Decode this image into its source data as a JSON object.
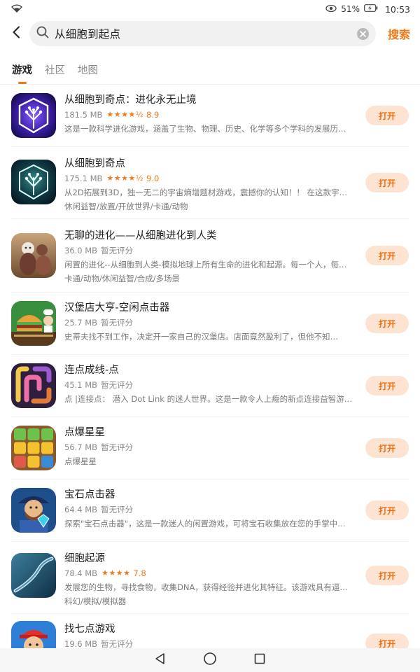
{
  "status_bar": {
    "battery": "51%",
    "time": "10:53"
  },
  "search": {
    "query": "从细胞到起点",
    "submit_label": "搜索"
  },
  "tabs": [
    {
      "label": "游戏",
      "active": true
    },
    {
      "label": "社区",
      "active": false
    },
    {
      "label": "地图",
      "active": false
    }
  ],
  "colors": {
    "accent": "#f07a1a",
    "button_bg": "#fde4d2"
  },
  "apps": [
    {
      "name": "从细胞到奇点：进化永无止境",
      "size": "181.5 MB",
      "stars": "★★★★½",
      "rating": "8.9",
      "desc": "这是一款科学进化游戏，涵盖了生物、物理、历史、化学等多个学科的发展历…",
      "tags": "",
      "button": "打开",
      "icon": "cell-to-singularity-tree-icon"
    },
    {
      "name": "从细胞到奇点",
      "size": "175.1 MB",
      "stars": "★★★★½",
      "rating": "9.0",
      "desc": "从2D拓展到3D，独一无二的宇宙熵增题材游戏，震撼你的认知！！ 在这款宇…",
      "tags": "休闲益智/放置/开放世界/卡通/动物",
      "button": "打开",
      "icon": "glowing-tree-icon"
    },
    {
      "name": "无聊的进化——从细胞进化到人类",
      "size": "36.0 MB",
      "unrated": "暂无评分",
      "desc": "闲置的进化--从细胞到人类-模拟地球上所有生命的进化和起源。每一个人，每…",
      "tags": "卡通/动物/休闲益智/合成/多场景",
      "button": "打开",
      "icon": "primate-icon"
    },
    {
      "name": "汉堡店大亨-空闲点击器",
      "size": "25.7 MB",
      "unrated": "暂无评分",
      "desc": "史蒂夫找不到工作，决定开一家自己的汉堡店。店面竟然盈利了，但他不知…",
      "tags": "",
      "button": "打开",
      "icon": "burger-shop-icon"
    },
    {
      "name": "连点成线-点",
      "size": "45.1 MB",
      "unrated": "暂无评分",
      "desc": "点 |连接点： 潜入 Dot Link 的迷人世界。这是一款令人上瘾的新点连接益智游…",
      "tags": "",
      "button": "打开",
      "icon": "pipe-puzzle-icon"
    },
    {
      "name": "点爆星星",
      "size": "56.7 MB",
      "unrated": "暂无评分",
      "desc": "点爆星星",
      "tags": "",
      "button": "打开",
      "icon": "color-blocks-icon"
    },
    {
      "name": "宝石点击器",
      "size": "64.4 MB",
      "unrated": "暂无评分",
      "desc": "探索\"宝石点击器\"，这是一款迷人的闲置游戏，可将宝石收集放在您的手掌中…",
      "tags": "",
      "button": "打开",
      "icon": "gem-miner-icon"
    },
    {
      "name": "细胞起源",
      "size": "78.4 MB",
      "stars": "★★★★",
      "rating": "7.8",
      "desc": "发展您的生物，寻找食物，收集DNA，获得经验并进化其特征。该游戏具有逼…",
      "tags": "科幻/模拟/模拟器",
      "button": "打开",
      "icon": "sea-creature-icon"
    },
    {
      "name": "找七点游戏",
      "size": "19.6 MB",
      "unrated": "暂无评分",
      "desc": "",
      "tags": "",
      "button": "打开",
      "icon": "cartoon-kid-icon"
    }
  ]
}
